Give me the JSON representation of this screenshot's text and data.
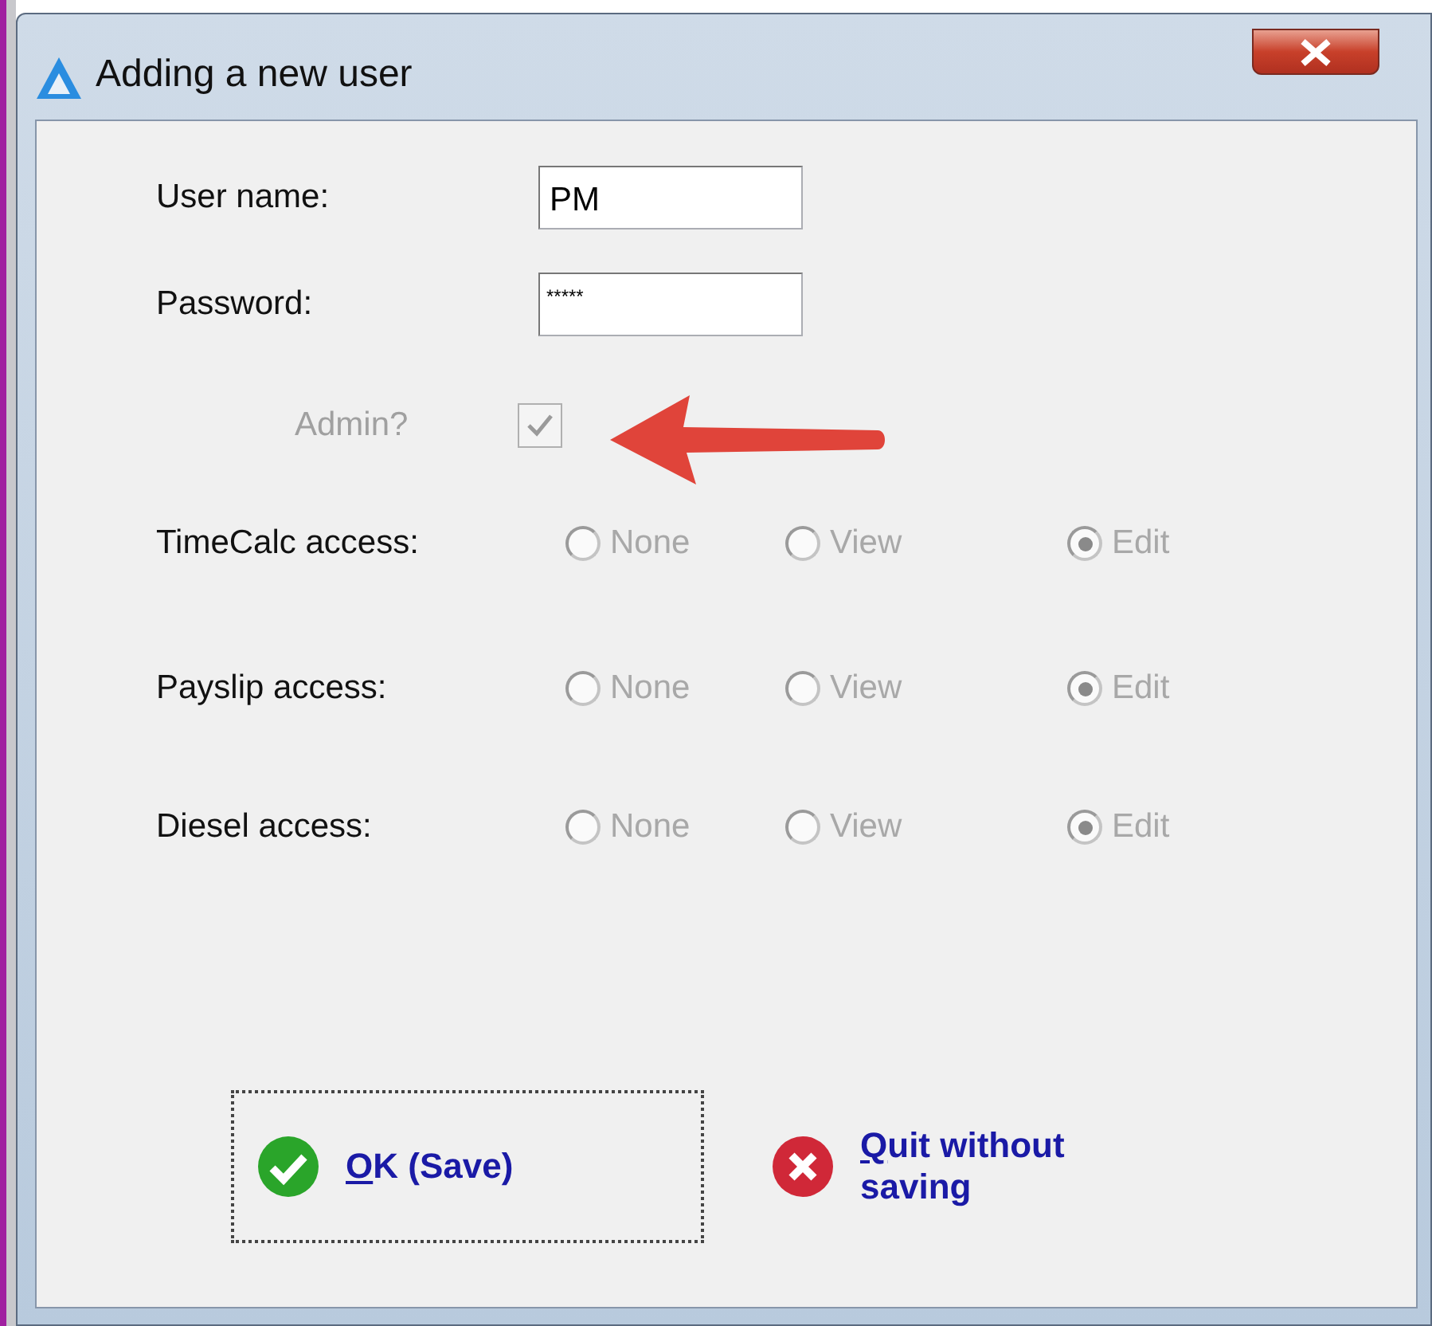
{
  "window": {
    "title": "Adding a new user"
  },
  "fields": [
    {
      "label": "User name:",
      "value": "PM",
      "kind": "text"
    },
    {
      "label": "Password:",
      "value": "*****",
      "kind": "password"
    }
  ],
  "admin": {
    "label": "Admin?",
    "checked": true,
    "disabled": true
  },
  "access": [
    {
      "label": "TimeCalc access:",
      "options": [
        {
          "label": "None",
          "selected": false,
          "disabled": true
        },
        {
          "label": "View",
          "selected": false,
          "disabled": true
        },
        {
          "label": "Edit",
          "selected": true,
          "disabled": true
        }
      ]
    },
    {
      "label": "Payslip access:",
      "options": [
        {
          "label": "None",
          "selected": false,
          "disabled": true
        },
        {
          "label": "View",
          "selected": false,
          "disabled": true
        },
        {
          "label": "Edit",
          "selected": true,
          "disabled": true
        }
      ]
    },
    {
      "label": "Diesel access:",
      "options": [
        {
          "label": "None",
          "selected": false,
          "disabled": true
        },
        {
          "label": "View",
          "selected": false,
          "disabled": true
        },
        {
          "label": "Edit",
          "selected": true,
          "disabled": true
        }
      ]
    }
  ],
  "buttons": [
    {
      "label": "OK (Save)",
      "kind": "ok",
      "focused": true
    },
    {
      "label": "Quit without saving",
      "kind": "quit",
      "focused": false
    }
  ]
}
